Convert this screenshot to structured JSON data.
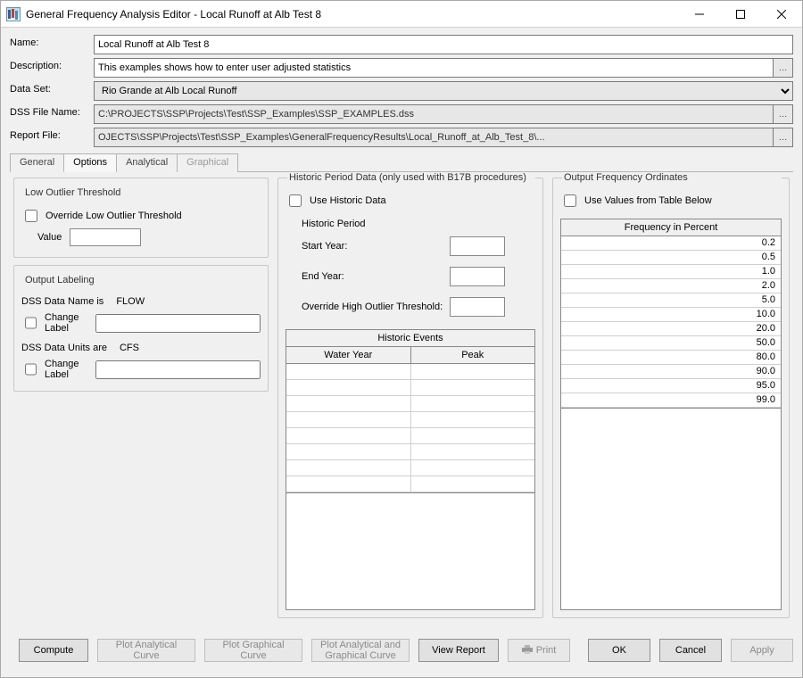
{
  "window": {
    "title": "General Frequency Analysis Editor - Local Runoff at Alb Test 8"
  },
  "form": {
    "name": {
      "label": "Name:",
      "value": "Local Runoff at Alb Test 8"
    },
    "description": {
      "label": "Description:",
      "value": "This examples shows how to enter user adjusted statistics"
    },
    "dataset": {
      "label": "Data Set:",
      "selected": "Rio Grande at Alb Local Runoff"
    },
    "dssfile": {
      "label": "DSS File Name:",
      "value": "C:\\PROJECTS\\SSP\\Projects\\Test\\SSP_Examples\\SSP_EXAMPLES.dss"
    },
    "reportfile": {
      "label": "Report File:",
      "value": "OJECTS\\SSP\\Projects\\Test\\SSP_Examples\\GeneralFrequencyResults\\Local_Runoff_at_Alb_Test_8\\..."
    }
  },
  "tabs": {
    "general": "General",
    "options": "Options",
    "analytical": "Analytical",
    "graphical": "Graphical",
    "active": "options"
  },
  "low_outlier": {
    "title": "Low Outlier Threshold",
    "override_label": "Override Low Outlier Threshold",
    "value_label": "Value"
  },
  "output_labeling": {
    "title": "Output Labeling",
    "data_name_label": "DSS Data Name is",
    "data_name_value": "FLOW",
    "change_label_1": "Change Label",
    "data_units_label": "DSS Data Units are",
    "data_units_value": "CFS",
    "change_label_2": "Change Label"
  },
  "historic": {
    "title": "Historic Period Data (only used with B17B procedures)",
    "use_label": "Use Historic Data",
    "period_label": "Historic Period",
    "start_label": "Start Year:",
    "end_label": "End Year:",
    "override_label": "Override High Outlier Threshold:",
    "events_title": "Historic Events",
    "col_water_year": "Water Year",
    "col_peak": "Peak",
    "rows": 8
  },
  "freq": {
    "title": "Output Frequency Ordinates",
    "use_label": "Use Values from Table Below",
    "table_head": "Frequency in Percent",
    "values": [
      "0.2",
      "0.5",
      "1.0",
      "2.0",
      "5.0",
      "10.0",
      "20.0",
      "50.0",
      "80.0",
      "90.0",
      "95.0",
      "99.0"
    ]
  },
  "buttons": {
    "compute": "Compute",
    "plot_analytical": "Plot Analytical Curve",
    "plot_graphical": "Plot Graphical Curve",
    "plot_both": "Plot Analytical and Graphical Curve",
    "view_report": "View Report",
    "print": "Print",
    "ok": "OK",
    "cancel": "Cancel",
    "apply": "Apply"
  }
}
